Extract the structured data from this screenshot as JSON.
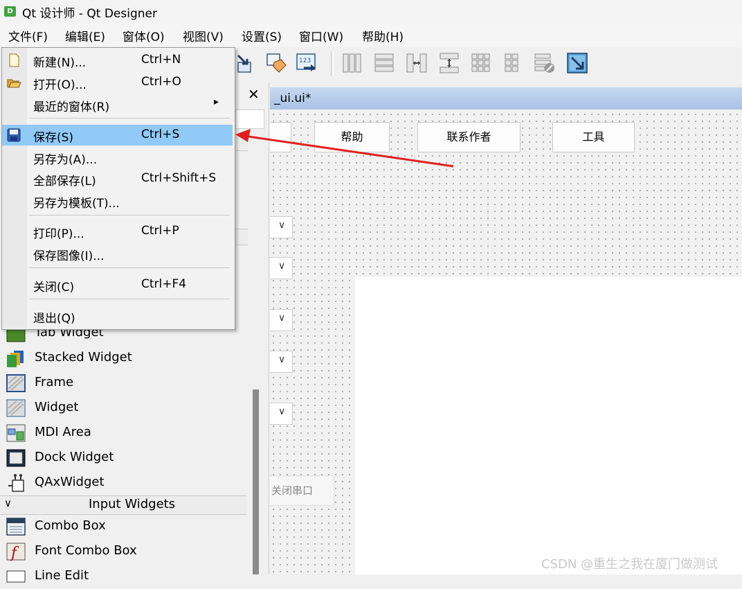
{
  "window": {
    "title": "Qt 设计师 - Qt Designer",
    "icon_letter": "D"
  },
  "menubar": [
    {
      "label": "文件(F)"
    },
    {
      "label": "编辑(E)"
    },
    {
      "label": "窗体(O)"
    },
    {
      "label": "视图(V)"
    },
    {
      "label": "设置(S)"
    },
    {
      "label": "窗口(W)"
    },
    {
      "label": "帮助(H)"
    }
  ],
  "file_menu": {
    "items": [
      {
        "label": "新建(N)...",
        "shortcut": "Ctrl+N",
        "icon": "new-file-icon"
      },
      {
        "label": "打开(O)...",
        "shortcut": "Ctrl+O",
        "icon": "folder-open-icon"
      },
      {
        "label": "最近的窗体(R)",
        "shortcut": "",
        "submenu": true
      },
      {
        "label": "保存(S)",
        "shortcut": "Ctrl+S",
        "icon": "save-icon",
        "highlighted": true
      },
      {
        "label": "另存为(A)...",
        "shortcut": ""
      },
      {
        "label": "全部保存(L)",
        "shortcut": "Ctrl+Shift+S"
      },
      {
        "label": "另存为模板(T)...",
        "shortcut": ""
      },
      {
        "label": "打印(P)...",
        "shortcut": "Ctrl+P"
      },
      {
        "label": "保存图像(I)...",
        "shortcut": ""
      },
      {
        "label": "关闭(C)",
        "shortcut": "Ctrl+F4"
      },
      {
        "label": "退出(Q)",
        "shortcut": ""
      }
    ],
    "submenu_arrow": "▸"
  },
  "toolbar": {
    "icons": [
      "send-to-back-icon",
      "edit-buddies-icon",
      "edit-tab-order-icon",
      "layout-horizontal-icon",
      "layout-vertical-icon",
      "layout-horizontal-splitter-icon",
      "layout-vertical-splitter-icon",
      "layout-grid-icon",
      "layout-form-icon",
      "break-layout-icon",
      "adjust-size-icon"
    ]
  },
  "widget_box": {
    "close_glyph": "✕",
    "items_top": [
      {
        "label": "Tab Widget",
        "icon": "tab-widget-icon"
      },
      {
        "label": "Stacked Widget",
        "icon": "stacked-widget-icon"
      },
      {
        "label": "Frame",
        "icon": "frame-icon"
      },
      {
        "label": "Widget",
        "icon": "widget-icon"
      },
      {
        "label": "MDI Area",
        "icon": "mdi-area-icon"
      },
      {
        "label": "Dock Widget",
        "icon": "dock-widget-icon"
      },
      {
        "label": "QAxWidget",
        "icon": "qaxwidget-icon"
      }
    ],
    "category": {
      "label": "Input Widgets",
      "chevron": "∨"
    },
    "items_input": [
      {
        "label": "Combo Box",
        "icon": "combo-box-icon"
      },
      {
        "label": "Font Combo Box",
        "icon": "font-combo-box-icon"
      },
      {
        "label": "Line Edit",
        "icon": "line-edit-icon"
      }
    ]
  },
  "form": {
    "title": "_ui.ui*",
    "buttons": [
      {
        "label": "帮助"
      },
      {
        "label": "联系作者"
      },
      {
        "label": "工具"
      }
    ],
    "combo_arrow": "∨",
    "close_port": "关闭串口"
  },
  "watermark": "CSDN @重生之我在厦门做测试",
  "colors": {
    "highlight": "#91c9f7",
    "arrow": "#e02020",
    "form_titlebar": "#b4cdea"
  }
}
